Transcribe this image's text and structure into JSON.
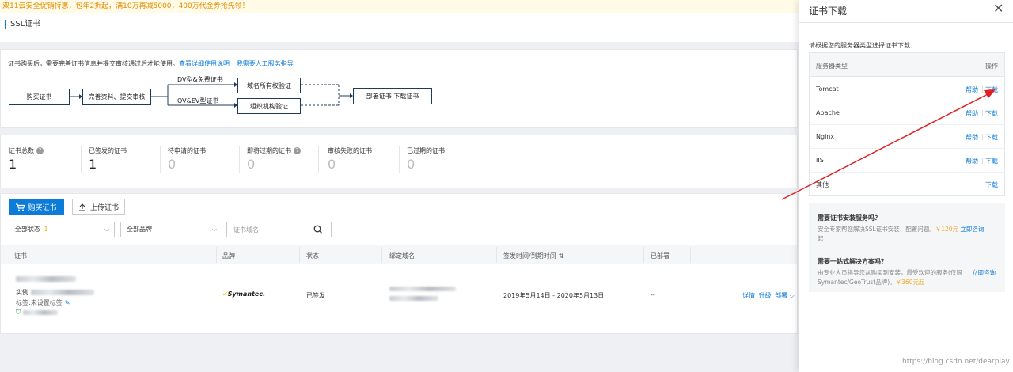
{
  "banner": {
    "text": "双11云安全促销特惠，包年2折起，满10万再减5000，400万代金券抢先领！"
  },
  "page": {
    "title": "SSL证书"
  },
  "flow": {
    "note": "证书购买后，需要完善证书信息并提交审核通过后才能使用。",
    "link_guide": "查看详细使用说明",
    "link_service": "我需要人工服务指导",
    "steps": {
      "buy": "购买证书",
      "complete": "完善资料、提交审核",
      "dv_label": "DV型&免费证书",
      "ov_label": "OV&EV型证书",
      "domain_verify": "域名所有权验证",
      "org_verify": "组织机构验证",
      "deploy": "部署证书    下载证书"
    }
  },
  "stats": [
    {
      "label": "证书总数",
      "value": "1",
      "help": true
    },
    {
      "label": "已签发的证书",
      "value": "1",
      "help": false
    },
    {
      "label": "待申请的证书",
      "value": "0",
      "help": false
    },
    {
      "label": "即将过期的证书",
      "value": "0",
      "help": true
    },
    {
      "label": "审核失败的证书",
      "value": "0",
      "help": false
    },
    {
      "label": "已过期的证书",
      "value": "0",
      "help": false
    }
  ],
  "toolbar": {
    "buy_label": "购买证书",
    "upload_label": "上传证书",
    "status_select": "全部状态",
    "status_count": "1",
    "brand_select": "全部品牌",
    "search_placeholder": "证书域名"
  },
  "table": {
    "headers": [
      "证书",
      "品牌",
      "状态",
      "绑定域名",
      "签发时间/到期时间",
      "已部署"
    ],
    "row": {
      "cert_type": "实例",
      "tag_note": "标签:未设置标签",
      "brand": "Symantec.",
      "status": "已签发",
      "period": "2019年5月14日 - 2020年5月13日",
      "deployed": "--",
      "actions": [
        "详情",
        "升级",
        "部署"
      ]
    }
  },
  "drawer": {
    "title": "证书下载",
    "prompt": "请根据您的服务器类型选择证书下载：",
    "col_server": "服务器类型",
    "col_action": "操作",
    "help_label": "帮助",
    "download_label": "下载",
    "servers": [
      {
        "name": "Tomcat",
        "help": true
      },
      {
        "name": "Apache",
        "help": true
      },
      {
        "name": "Nginx",
        "help": true
      },
      {
        "name": "IIS",
        "help": true
      },
      {
        "name": "其他",
        "help": false
      }
    ],
    "promo1": {
      "title": "需要证书安装服务吗？",
      "text": "安全专家帮您解决SSL证书安装、配置问题。",
      "price": "￥120元",
      "link": "立即咨询",
      "tail": "起"
    },
    "promo2": {
      "title": "需要一站式解决方案吗？",
      "text": "由专业人员指导您从购买到安装，最受欢迎的服务(仅限Symantec/GeoTrust品牌)。",
      "price": "￥360元起",
      "link": "立即咨询"
    }
  },
  "watermark": "https://blog.csdn.net/dearplay",
  "colors": {
    "accent": "#0d7bd8",
    "arrow": "#e02020",
    "banner_text": "#e58a00"
  }
}
